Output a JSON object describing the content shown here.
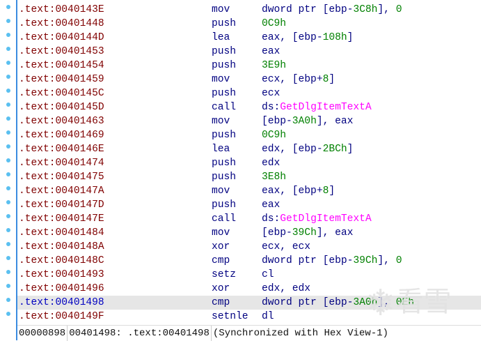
{
  "rows": [
    {
      "addr": ".text:0040143E",
      "mn": "mov",
      "ops": [
        [
          "dword ptr [ebp-",
          "r"
        ],
        [
          "3C8h",
          "n"
        ],
        [
          "], ",
          "r"
        ],
        [
          "0",
          "n"
        ]
      ]
    },
    {
      "addr": ".text:00401448",
      "mn": "push",
      "ops": [
        [
          "0C9h",
          "n"
        ]
      ]
    },
    {
      "addr": ".text:0040144D",
      "mn": "lea",
      "ops": [
        [
          "eax, [ebp-",
          "r"
        ],
        [
          "108h",
          "n"
        ],
        [
          "]",
          "r"
        ]
      ]
    },
    {
      "addr": ".text:00401453",
      "mn": "push",
      "ops": [
        [
          "eax",
          "r"
        ]
      ]
    },
    {
      "addr": ".text:00401454",
      "mn": "push",
      "ops": [
        [
          "3E9h",
          "n"
        ]
      ]
    },
    {
      "addr": ".text:00401459",
      "mn": "mov",
      "ops": [
        [
          "ecx, [ebp+",
          "r"
        ],
        [
          "8",
          "n"
        ],
        [
          "]",
          "r"
        ]
      ]
    },
    {
      "addr": ".text:0040145C",
      "mn": "push",
      "ops": [
        [
          "ecx",
          "r"
        ]
      ]
    },
    {
      "addr": ".text:0040145D",
      "mn": "call",
      "ops": [
        [
          "ds:",
          "r"
        ],
        [
          "GetDlgItemTextA",
          "f"
        ]
      ]
    },
    {
      "addr": ".text:00401463",
      "mn": "mov",
      "ops": [
        [
          "[ebp-",
          "r"
        ],
        [
          "3A0h",
          "n"
        ],
        [
          "], eax",
          "r"
        ]
      ]
    },
    {
      "addr": ".text:00401469",
      "mn": "push",
      "ops": [
        [
          "0C9h",
          "n"
        ]
      ]
    },
    {
      "addr": ".text:0040146E",
      "mn": "lea",
      "ops": [
        [
          "edx, [ebp-",
          "r"
        ],
        [
          "2BCh",
          "n"
        ],
        [
          "]",
          "r"
        ]
      ]
    },
    {
      "addr": ".text:00401474",
      "mn": "push",
      "ops": [
        [
          "edx",
          "r"
        ]
      ]
    },
    {
      "addr": ".text:00401475",
      "mn": "push",
      "ops": [
        [
          "3E8h",
          "n"
        ]
      ]
    },
    {
      "addr": ".text:0040147A",
      "mn": "mov",
      "ops": [
        [
          "eax, [ebp+",
          "r"
        ],
        [
          "8",
          "n"
        ],
        [
          "]",
          "r"
        ]
      ]
    },
    {
      "addr": ".text:0040147D",
      "mn": "push",
      "ops": [
        [
          "eax",
          "r"
        ]
      ]
    },
    {
      "addr": ".text:0040147E",
      "mn": "call",
      "ops": [
        [
          "ds:",
          "r"
        ],
        [
          "GetDlgItemTextA",
          "f"
        ]
      ]
    },
    {
      "addr": ".text:00401484",
      "mn": "mov",
      "ops": [
        [
          "[ebp-",
          "r"
        ],
        [
          "39Ch",
          "n"
        ],
        [
          "], eax",
          "r"
        ]
      ]
    },
    {
      "addr": ".text:0040148A",
      "mn": "xor",
      "ops": [
        [
          "ecx, ecx",
          "r"
        ]
      ]
    },
    {
      "addr": ".text:0040148C",
      "mn": "cmp",
      "ops": [
        [
          "dword ptr [ebp-",
          "r"
        ],
        [
          "39Ch",
          "n"
        ],
        [
          "], ",
          "r"
        ],
        [
          "0",
          "n"
        ]
      ]
    },
    {
      "addr": ".text:00401493",
      "mn": "setz",
      "ops": [
        [
          "cl",
          "r"
        ]
      ]
    },
    {
      "addr": ".text:00401496",
      "mn": "xor",
      "ops": [
        [
          "edx, edx",
          "r"
        ]
      ]
    },
    {
      "addr": ".text:00401498",
      "mn": "cmp",
      "ops": [
        [
          "dword ptr [ebp-",
          "r"
        ],
        [
          "3A0h",
          "n"
        ],
        [
          "], ",
          "r"
        ],
        [
          "0Eh",
          "n"
        ]
      ],
      "highlighted": true
    },
    {
      "addr": ".text:0040149F",
      "mn": "setnle",
      "ops": [
        [
          "dl",
          "r"
        ]
      ]
    }
  ],
  "status": {
    "offset": "00000898",
    "location": "00401498: .text:00401498",
    "sync": "(Synchronized with Hex View-1)"
  },
  "watermark": {
    "text": "看雪",
    "icon": "snowflake-icon"
  },
  "colors": {
    "address": "#800000",
    "current_address": "#0000c0",
    "mnemonic": "#000080",
    "number": "#008000",
    "import_name": "#ff00ff",
    "highlight": "#e6e6e6"
  }
}
